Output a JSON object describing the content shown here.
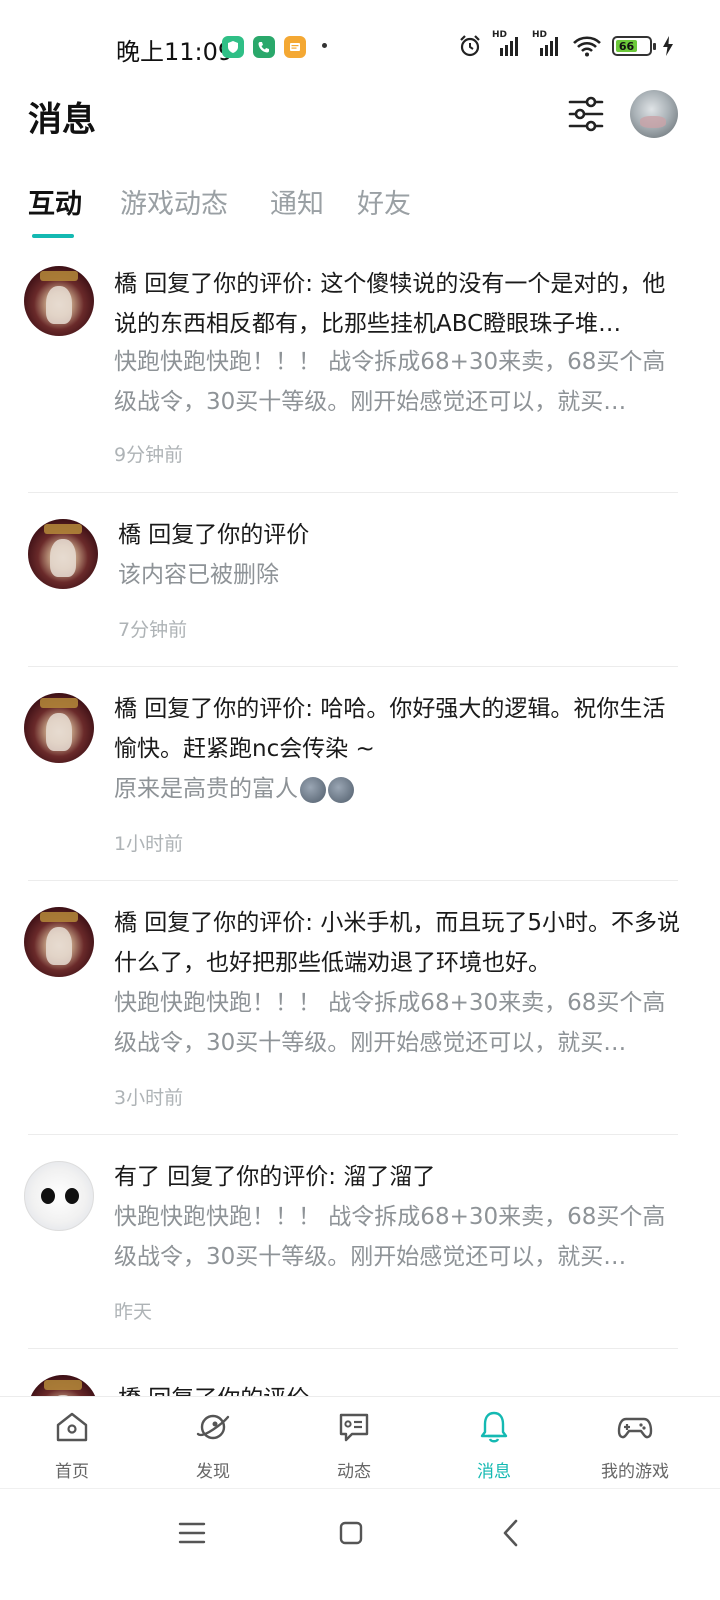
{
  "status_bar": {
    "time": "晚上11:09",
    "battery_level": "66",
    "network": "HD",
    "icons": [
      "shield-app-icon",
      "phone-app-icon",
      "notes-app-icon",
      "alarm-icon",
      "signal-icon",
      "wifi-icon",
      "battery-icon",
      "charging-icon"
    ]
  },
  "header": {
    "title": "消息",
    "filter_icon": "sliders-icon",
    "avatar_icon": "user-avatar"
  },
  "tabs": [
    {
      "label": "互动",
      "active": true
    },
    {
      "label": "游戏动态",
      "active": false
    },
    {
      "label": "通知",
      "active": false
    },
    {
      "label": "好友",
      "active": false
    }
  ],
  "messages": [
    {
      "title": "橋 回复了你的评价: 这个傻犊说的没有一个是对的，他说的东西相反都有，比那些挂机ABC瞪眼珠子堆…",
      "quote": "快跑快跑快跑！！！ 战令拆成68+30来卖，68买个高级战令，30买十等级。刚开始感觉还可以，就买…",
      "time": "9分钟前"
    },
    {
      "title": "橋 回复了你的评价",
      "quote": "该内容已被删除",
      "time": "7分钟前"
    },
    {
      "title": "橋 回复了你的评价: 哈哈。你好强大的逻辑。祝你生活愉快。赶紧跑nc会传染 ~",
      "quote": "原来是高贵的富人",
      "time": "1小时前"
    },
    {
      "title": "橋 回复了你的评价: 小米手机，而且玩了5小时。不多说什么了，也好把那些低端劝退了环境也好。",
      "quote": "快跑快跑快跑！！！ 战令拆成68+30来卖，68买个高级战令，30买十等级。刚开始感觉还可以，就买…",
      "time": "3小时前"
    },
    {
      "title": "有了 回复了你的评价: 溜了溜了",
      "quote": "快跑快跑快跑！！！ 战令拆成68+30来卖，68买个高级战令，30买十等级。刚开始感觉还可以，就买…",
      "time": "昨天"
    },
    {
      "title": "橋 回复了你的评价",
      "quote": "",
      "time": ""
    }
  ],
  "bottom_nav": [
    {
      "label": "首页",
      "icon": "home-icon",
      "active": false
    },
    {
      "label": "发现",
      "icon": "discover-icon",
      "active": false
    },
    {
      "label": "动态",
      "icon": "feed-icon",
      "active": false
    },
    {
      "label": "消息",
      "icon": "bell-icon",
      "active": true
    },
    {
      "label": "我的游戏",
      "icon": "gamepad-icon",
      "active": false
    }
  ],
  "system_nav": [
    "menu-icon",
    "home-square-icon",
    "back-icon"
  ],
  "colors": {
    "accent": "#14b9b2",
    "text_primary": "#1a1a1a",
    "text_secondary": "#8e9397",
    "text_time": "#aeb3b6"
  }
}
